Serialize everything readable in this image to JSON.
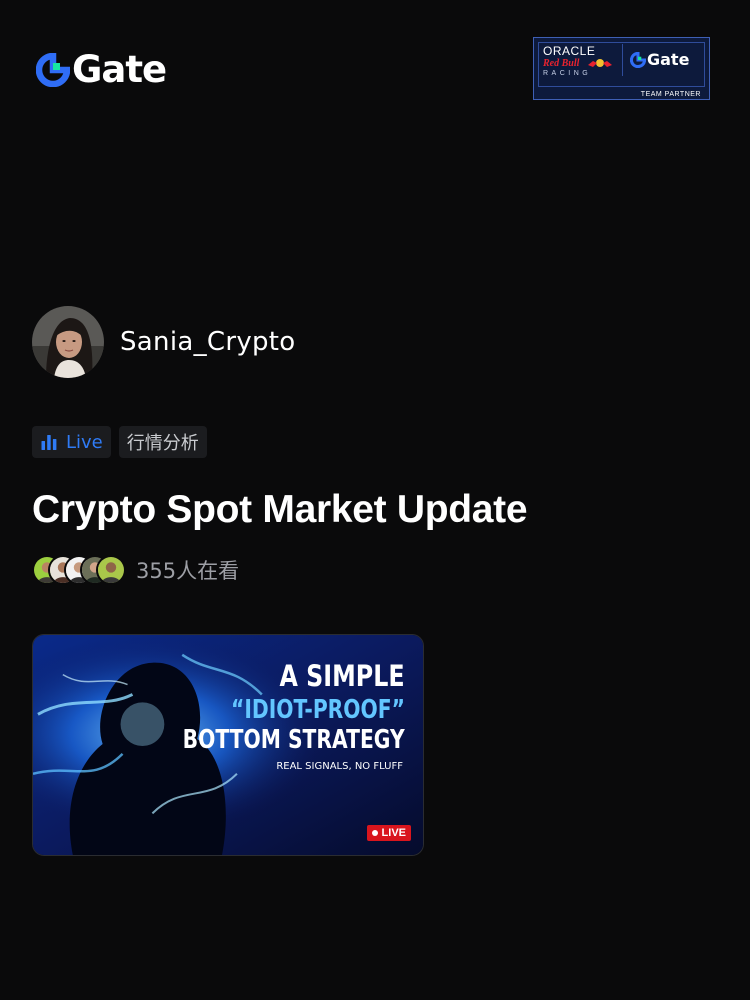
{
  "header": {
    "brand_name": "Gate",
    "logo_icon": "gate-logo-icon",
    "partner_badge": {
      "oracle": "ORACLE",
      "red_bull": "Red Bull",
      "racing": "RACING",
      "gate": "Gate",
      "team_partner": "TEAM PARTNER"
    }
  },
  "host": {
    "name": "Sania_Crypto",
    "avatar_icon": "host-avatar"
  },
  "tags": {
    "live_label": "Live",
    "live_icon": "bar-chart-icon",
    "topic_label": "行情分析"
  },
  "stream": {
    "title": "Crypto Spot Market Update",
    "viewer_count": "355人在看",
    "viewer_avatars": 5
  },
  "thumbnail": {
    "line1": "A SIMPLE",
    "line2": "“IDIOT-PROOF”",
    "line3": "BOTTOM STRATEGY",
    "line4": "REAL SIGNALS, NO FLUFF",
    "live_badge": "LIVE"
  },
  "colors": {
    "background": "#0a0a0b",
    "accent_blue": "#2f7bf5",
    "gate_teal": "#17e6a1",
    "live_red": "#d9151d",
    "muted_text": "#9d9fa5"
  }
}
